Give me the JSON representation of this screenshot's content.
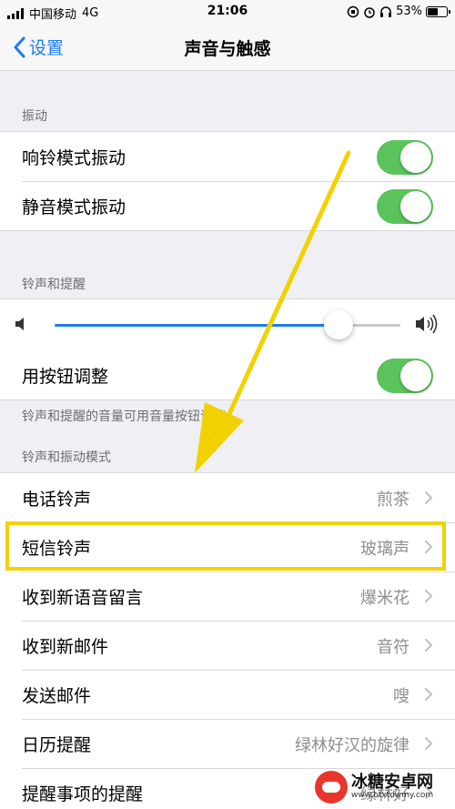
{
  "status_bar": {
    "carrier": "中国移动",
    "network": "4G",
    "time": "21:06",
    "battery": "53%",
    "battery_level": 0.53
  },
  "nav": {
    "back_label": "设置",
    "title": "声音与触感"
  },
  "vibration": {
    "header": "振动",
    "items": [
      {
        "label": "响铃模式振动",
        "on": true
      },
      {
        "label": "静音模式振动",
        "on": true
      }
    ]
  },
  "ringer": {
    "header": "铃声和提醒",
    "volume_level": 0.82,
    "adjust_label": "用按钮调整",
    "adjust_on": true,
    "footnote": "铃声和提醒的音量可用音量按钮调整。"
  },
  "patterns": {
    "header": "铃声和振动模式",
    "items": [
      {
        "label": "电话铃声",
        "value": "煎茶"
      },
      {
        "label": "短信铃声",
        "value": "玻璃声"
      },
      {
        "label": "收到新语音留言",
        "value": "爆米花"
      },
      {
        "label": "收到新邮件",
        "value": "音符"
      },
      {
        "label": "发送邮件",
        "value": "嗖"
      },
      {
        "label": "日历提醒",
        "value": "绿林好汉的旋律"
      },
      {
        "label": "提醒事项的提醒",
        "value": "绿林好"
      }
    ]
  },
  "colors": {
    "accent": "#1a7cf5",
    "toggle_on": "#5bc35c",
    "annotation": "#f1d200"
  },
  "watermark": {
    "name": "冰糖安卓网",
    "url": "www.btxtdwmy.com"
  }
}
